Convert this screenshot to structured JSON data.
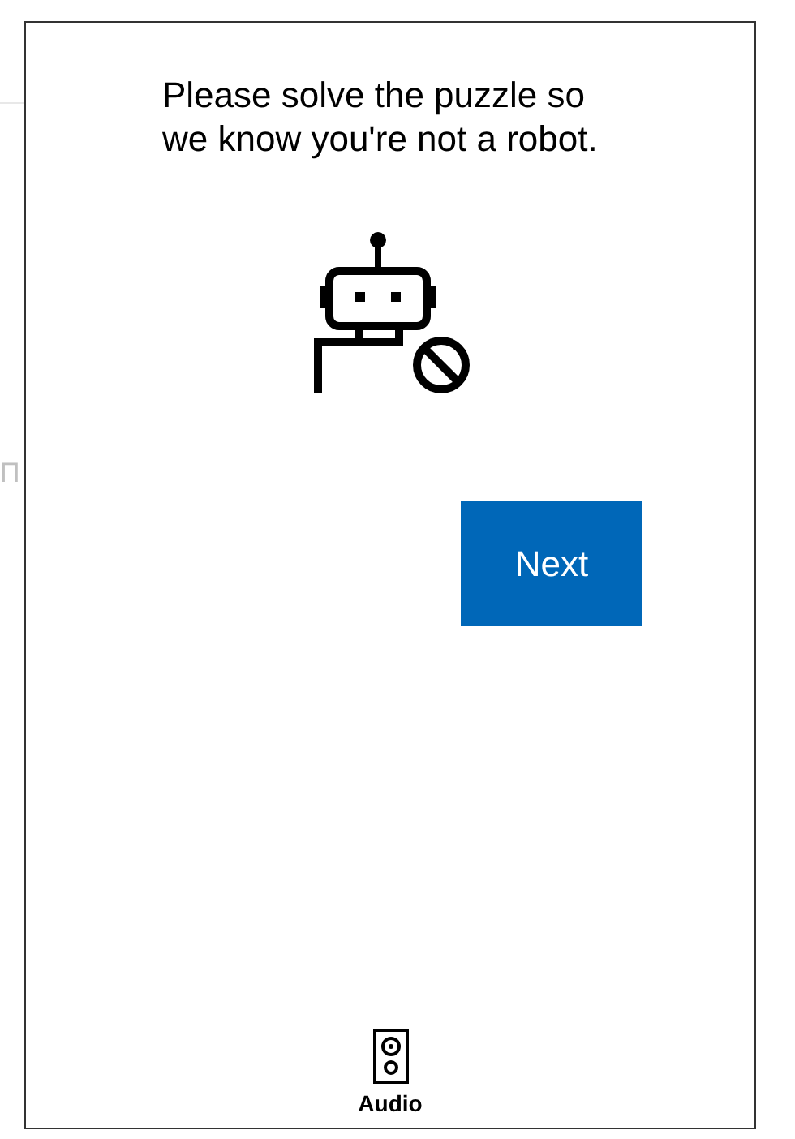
{
  "background_text": "П",
  "prompt": "Please solve the puzzle so we know you're not a robot.",
  "next_button": "Next",
  "audio_button": "Audio"
}
